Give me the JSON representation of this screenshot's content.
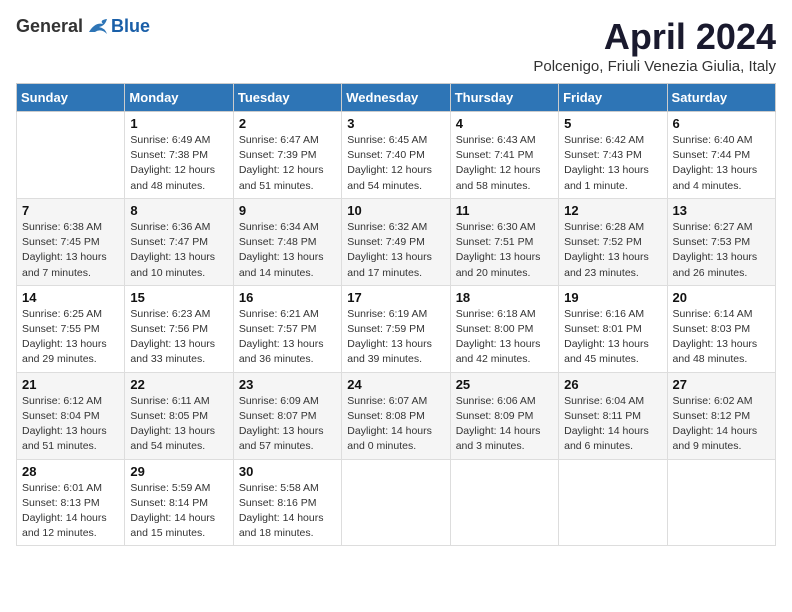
{
  "header": {
    "logo_general": "General",
    "logo_blue": "Blue",
    "month_year": "April 2024",
    "location": "Polcenigo, Friuli Venezia Giulia, Italy"
  },
  "days_of_week": [
    "Sunday",
    "Monday",
    "Tuesday",
    "Wednesday",
    "Thursday",
    "Friday",
    "Saturday"
  ],
  "weeks": [
    [
      {
        "day": "",
        "sunrise": "",
        "sunset": "",
        "daylight": ""
      },
      {
        "day": "1",
        "sunrise": "Sunrise: 6:49 AM",
        "sunset": "Sunset: 7:38 PM",
        "daylight": "Daylight: 12 hours and 48 minutes."
      },
      {
        "day": "2",
        "sunrise": "Sunrise: 6:47 AM",
        "sunset": "Sunset: 7:39 PM",
        "daylight": "Daylight: 12 hours and 51 minutes."
      },
      {
        "day": "3",
        "sunrise": "Sunrise: 6:45 AM",
        "sunset": "Sunset: 7:40 PM",
        "daylight": "Daylight: 12 hours and 54 minutes."
      },
      {
        "day": "4",
        "sunrise": "Sunrise: 6:43 AM",
        "sunset": "Sunset: 7:41 PM",
        "daylight": "Daylight: 12 hours and 58 minutes."
      },
      {
        "day": "5",
        "sunrise": "Sunrise: 6:42 AM",
        "sunset": "Sunset: 7:43 PM",
        "daylight": "Daylight: 13 hours and 1 minute."
      },
      {
        "day": "6",
        "sunrise": "Sunrise: 6:40 AM",
        "sunset": "Sunset: 7:44 PM",
        "daylight": "Daylight: 13 hours and 4 minutes."
      }
    ],
    [
      {
        "day": "7",
        "sunrise": "Sunrise: 6:38 AM",
        "sunset": "Sunset: 7:45 PM",
        "daylight": "Daylight: 13 hours and 7 minutes."
      },
      {
        "day": "8",
        "sunrise": "Sunrise: 6:36 AM",
        "sunset": "Sunset: 7:47 PM",
        "daylight": "Daylight: 13 hours and 10 minutes."
      },
      {
        "day": "9",
        "sunrise": "Sunrise: 6:34 AM",
        "sunset": "Sunset: 7:48 PM",
        "daylight": "Daylight: 13 hours and 14 minutes."
      },
      {
        "day": "10",
        "sunrise": "Sunrise: 6:32 AM",
        "sunset": "Sunset: 7:49 PM",
        "daylight": "Daylight: 13 hours and 17 minutes."
      },
      {
        "day": "11",
        "sunrise": "Sunrise: 6:30 AM",
        "sunset": "Sunset: 7:51 PM",
        "daylight": "Daylight: 13 hours and 20 minutes."
      },
      {
        "day": "12",
        "sunrise": "Sunrise: 6:28 AM",
        "sunset": "Sunset: 7:52 PM",
        "daylight": "Daylight: 13 hours and 23 minutes."
      },
      {
        "day": "13",
        "sunrise": "Sunrise: 6:27 AM",
        "sunset": "Sunset: 7:53 PM",
        "daylight": "Daylight: 13 hours and 26 minutes."
      }
    ],
    [
      {
        "day": "14",
        "sunrise": "Sunrise: 6:25 AM",
        "sunset": "Sunset: 7:55 PM",
        "daylight": "Daylight: 13 hours and 29 minutes."
      },
      {
        "day": "15",
        "sunrise": "Sunrise: 6:23 AM",
        "sunset": "Sunset: 7:56 PM",
        "daylight": "Daylight: 13 hours and 33 minutes."
      },
      {
        "day": "16",
        "sunrise": "Sunrise: 6:21 AM",
        "sunset": "Sunset: 7:57 PM",
        "daylight": "Daylight: 13 hours and 36 minutes."
      },
      {
        "day": "17",
        "sunrise": "Sunrise: 6:19 AM",
        "sunset": "Sunset: 7:59 PM",
        "daylight": "Daylight: 13 hours and 39 minutes."
      },
      {
        "day": "18",
        "sunrise": "Sunrise: 6:18 AM",
        "sunset": "Sunset: 8:00 PM",
        "daylight": "Daylight: 13 hours and 42 minutes."
      },
      {
        "day": "19",
        "sunrise": "Sunrise: 6:16 AM",
        "sunset": "Sunset: 8:01 PM",
        "daylight": "Daylight: 13 hours and 45 minutes."
      },
      {
        "day": "20",
        "sunrise": "Sunrise: 6:14 AM",
        "sunset": "Sunset: 8:03 PM",
        "daylight": "Daylight: 13 hours and 48 minutes."
      }
    ],
    [
      {
        "day": "21",
        "sunrise": "Sunrise: 6:12 AM",
        "sunset": "Sunset: 8:04 PM",
        "daylight": "Daylight: 13 hours and 51 minutes."
      },
      {
        "day": "22",
        "sunrise": "Sunrise: 6:11 AM",
        "sunset": "Sunset: 8:05 PM",
        "daylight": "Daylight: 13 hours and 54 minutes."
      },
      {
        "day": "23",
        "sunrise": "Sunrise: 6:09 AM",
        "sunset": "Sunset: 8:07 PM",
        "daylight": "Daylight: 13 hours and 57 minutes."
      },
      {
        "day": "24",
        "sunrise": "Sunrise: 6:07 AM",
        "sunset": "Sunset: 8:08 PM",
        "daylight": "Daylight: 14 hours and 0 minutes."
      },
      {
        "day": "25",
        "sunrise": "Sunrise: 6:06 AM",
        "sunset": "Sunset: 8:09 PM",
        "daylight": "Daylight: 14 hours and 3 minutes."
      },
      {
        "day": "26",
        "sunrise": "Sunrise: 6:04 AM",
        "sunset": "Sunset: 8:11 PM",
        "daylight": "Daylight: 14 hours and 6 minutes."
      },
      {
        "day": "27",
        "sunrise": "Sunrise: 6:02 AM",
        "sunset": "Sunset: 8:12 PM",
        "daylight": "Daylight: 14 hours and 9 minutes."
      }
    ],
    [
      {
        "day": "28",
        "sunrise": "Sunrise: 6:01 AM",
        "sunset": "Sunset: 8:13 PM",
        "daylight": "Daylight: 14 hours and 12 minutes."
      },
      {
        "day": "29",
        "sunrise": "Sunrise: 5:59 AM",
        "sunset": "Sunset: 8:14 PM",
        "daylight": "Daylight: 14 hours and 15 minutes."
      },
      {
        "day": "30",
        "sunrise": "Sunrise: 5:58 AM",
        "sunset": "Sunset: 8:16 PM",
        "daylight": "Daylight: 14 hours and 18 minutes."
      },
      {
        "day": "",
        "sunrise": "",
        "sunset": "",
        "daylight": ""
      },
      {
        "day": "",
        "sunrise": "",
        "sunset": "",
        "daylight": ""
      },
      {
        "day": "",
        "sunrise": "",
        "sunset": "",
        "daylight": ""
      },
      {
        "day": "",
        "sunrise": "",
        "sunset": "",
        "daylight": ""
      }
    ]
  ]
}
